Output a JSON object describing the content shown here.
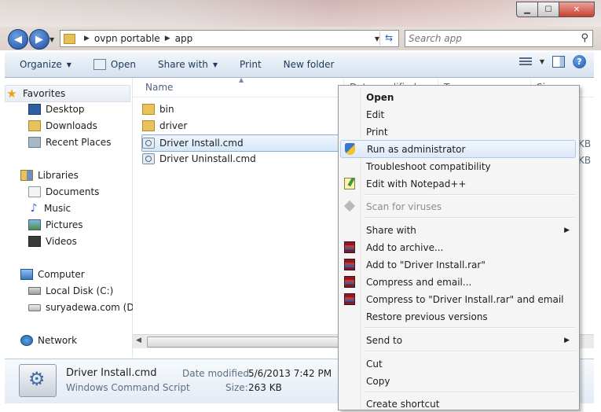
{
  "address": {
    "segments": [
      "ovpn portable",
      "app"
    ],
    "search_placeholder": "Search app"
  },
  "toolbar": {
    "organize": "Organize",
    "open": "Open",
    "share_with": "Share with",
    "print": "Print",
    "new_folder": "New folder"
  },
  "nav": {
    "favorites": "Favorites",
    "desktop": "Desktop",
    "downloads": "Downloads",
    "recent_places": "Recent Places",
    "libraries": "Libraries",
    "documents": "Documents",
    "music": "Music",
    "pictures": "Pictures",
    "videos": "Videos",
    "computer": "Computer",
    "local_disk": "Local Disk (C:)",
    "removable": "suryadewa.com (D:)",
    "network": "Network"
  },
  "filelist": {
    "columns": [
      "Name",
      "Date modified",
      "Type",
      "Size"
    ],
    "rows": [
      {
        "name": "bin",
        "type": "folder"
      },
      {
        "name": "driver",
        "type": "folder"
      },
      {
        "name": "Driver Install.cmd",
        "type": "cmd",
        "size_partial": "KB"
      },
      {
        "name": "Driver Uninstall.cmd",
        "type": "cmd",
        "size_partial": "KB"
      }
    ]
  },
  "details": {
    "name": "Driver Install.cmd",
    "type": "Windows Command Script",
    "date_label": "Date modified:",
    "date_value": "5/6/2013 7:42 PM",
    "size_label": "Size:",
    "size_value": "263 KB"
  },
  "context_menu": {
    "items": [
      {
        "label": "Open"
      },
      {
        "label": "Edit"
      },
      {
        "label": "Print"
      },
      {
        "label": "Run as administrator"
      },
      {
        "label": "Troubleshoot compatibility"
      },
      {
        "label": "Edit with Notepad++"
      },
      {
        "label": "Scan for viruses"
      },
      {
        "label": "Share with"
      },
      {
        "label": "Add to archive..."
      },
      {
        "label": "Add to \"Driver Install.rar\""
      },
      {
        "label": "Compress and email..."
      },
      {
        "label": "Compress to \"Driver Install.rar\" and email"
      },
      {
        "label": "Restore previous versions"
      },
      {
        "label": "Send to"
      },
      {
        "label": "Cut"
      },
      {
        "label": "Copy"
      },
      {
        "label": "Create shortcut"
      }
    ]
  }
}
